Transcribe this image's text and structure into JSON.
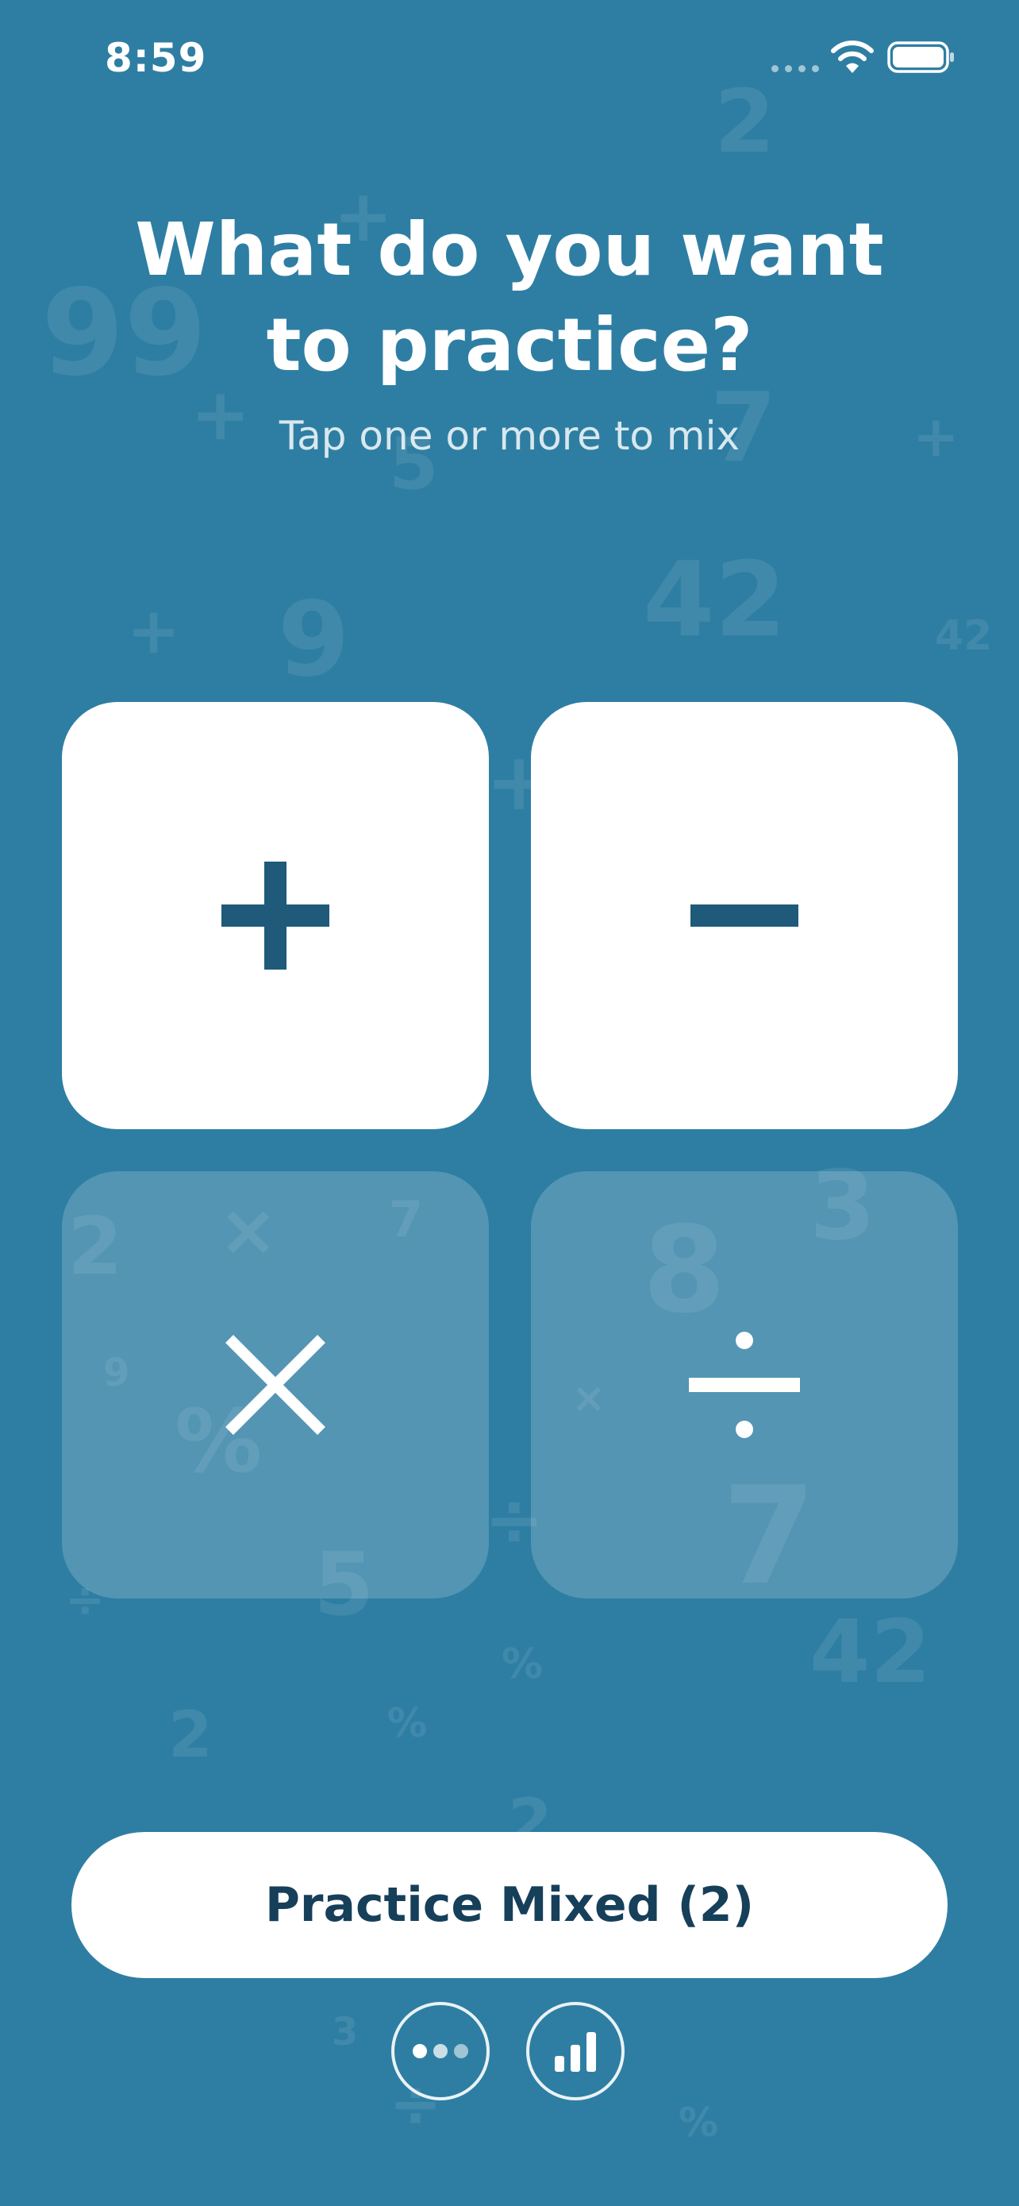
{
  "status_bar": {
    "time": "8:59"
  },
  "header": {
    "title": "What do you want\nto practice?",
    "subtitle": "Tap one or more to mix"
  },
  "operations": [
    {
      "name": "addition",
      "symbol": "plus-icon",
      "selected": true
    },
    {
      "name": "subtraction",
      "symbol": "minus-icon",
      "selected": true
    },
    {
      "name": "multiplication",
      "symbol": "times-icon",
      "selected": false
    },
    {
      "name": "division",
      "symbol": "divide-icon",
      "selected": false
    }
  ],
  "actions": {
    "practice_label": "Practice Mixed (2)",
    "more_icon": "ellipsis-icon",
    "stats_icon": "bar-chart-icon"
  },
  "background_glyphs": [
    "2",
    "99",
    "+",
    "+",
    "5",
    "7",
    "+",
    "+",
    "9",
    "42",
    "42",
    "+",
    "2",
    "×",
    "7",
    "9",
    "%",
    "8",
    "3",
    "×",
    "7",
    "÷",
    "5",
    "÷",
    "%",
    "42",
    "%",
    "2",
    "2",
    "3",
    "÷",
    "%"
  ],
  "colors": {
    "background": "#2e7ea3",
    "selected_tile": "#ffffff",
    "selected_symbol": "#1f5a7a",
    "unselected_tile": "rgba(255,255,255,0.18)",
    "button_text": "#163f5a"
  }
}
